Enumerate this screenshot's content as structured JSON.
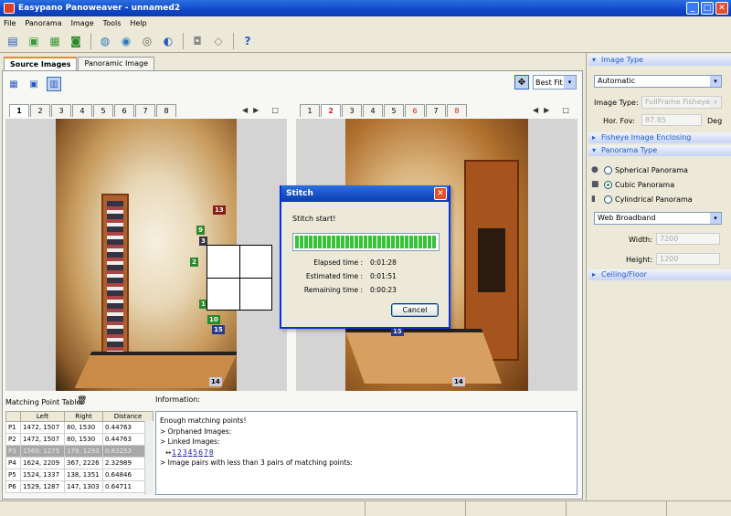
{
  "window": {
    "title": "Easypano Panoweaver - unnamed2",
    "min": "_",
    "max": "□",
    "close": "✕"
  },
  "menu": [
    "File",
    "Panorama",
    "Image",
    "Tools",
    "Help"
  ],
  "main_tabs": [
    "Source Images",
    "Panoramic Image"
  ],
  "fit": {
    "value": "Best Fit",
    "arrow": "▾"
  },
  "left_tabs": [
    "1",
    "2",
    "3",
    "4",
    "5",
    "6",
    "7",
    "8"
  ],
  "right_tabs": [
    "1",
    "2",
    "3",
    "4",
    "5",
    "6",
    "7",
    "8"
  ],
  "right_tabs_red": [
    1,
    5,
    7
  ],
  "nav": {
    "prev": "◀",
    "next": "▶",
    "box": "□"
  },
  "left_photo_tags": [
    "13",
    "9",
    "3",
    "2",
    "1",
    "10",
    "15",
    "14"
  ],
  "right_photo_tags": [
    "15",
    "14"
  ],
  "matching": {
    "label": "Matching Point Table:",
    "trash": "🗑",
    "headers": [
      "",
      "Left",
      "Right",
      "Distance"
    ],
    "rows": [
      [
        "P1",
        "1472, 1507",
        "80, 1530",
        "0.44763"
      ],
      [
        "P2",
        "1472, 1507",
        "80, 1530",
        "0.44763"
      ],
      [
        "P3",
        "1560, 1275",
        "179, 1293",
        "0.83253"
      ],
      [
        "P4",
        "1624, 2209",
        "367, 2226",
        "2.32989"
      ],
      [
        "P5",
        "1524, 1337",
        "138, 1351",
        "0.64846"
      ],
      [
        "P6",
        "1529, 1287",
        "147, 1303",
        "0.64711"
      ]
    ],
    "selected_row": 2
  },
  "information": {
    "label": "Information:",
    "lines": [
      "Enough matching points!",
      "> Orphaned Images:",
      "> Linked Images:"
    ],
    "link_prefix": "↔",
    "links": [
      "1",
      "2",
      "3",
      "4",
      "5",
      "6",
      "7",
      "8"
    ],
    "last_line": "> Image pairs with less than 3 pairs of matching points:"
  },
  "right_panel": {
    "image_type_header": "Image Type",
    "image_type_value": "Automatic",
    "image_type_label": "Image Type:",
    "image_type_sub": "FullFrame Fisheye",
    "hor_fov_label": "Hor. Fov:",
    "hor_fov_value": "87.85",
    "deg": "Deg",
    "fisheye_header": "Fisheye Image Enclosing",
    "pano_type_header": "Panorama Type",
    "pano_types": [
      "Spherical Panorama",
      "Cubic Panorama",
      "Cylindrical Panorama"
    ],
    "selected_pano_type": 1,
    "preset": "Web Broadband",
    "width_label": "Width:",
    "width_value": "7200",
    "height_label": "Height:",
    "height_value": "1200",
    "ceiling_header": "Ceiling/Floor"
  },
  "dialog": {
    "title": "Stitch",
    "close": "✕",
    "message": "Stitch start!",
    "progress": 1.0,
    "elapsed_label": "Elapsed time :",
    "elapsed": "0:01:28",
    "estimated_label": "Estimated time :",
    "estimated": "0:01:51",
    "remaining_label": "Remaining time :",
    "remaining": "0:00:23",
    "cancel": "Cancel"
  },
  "icons": {
    "toolbar": [
      "new-project-icon",
      "open-image-icon",
      "save-icon",
      "stitch-360-icon",
      "globe-icon",
      "globe-multi-icon",
      "sphere-icon",
      "eye-icon",
      "publish-360-icon",
      "diamond-icon",
      "help-icon"
    ],
    "view": [
      "thumbnail-view-icon",
      "single-view-icon",
      "link-view-icon"
    ]
  }
}
